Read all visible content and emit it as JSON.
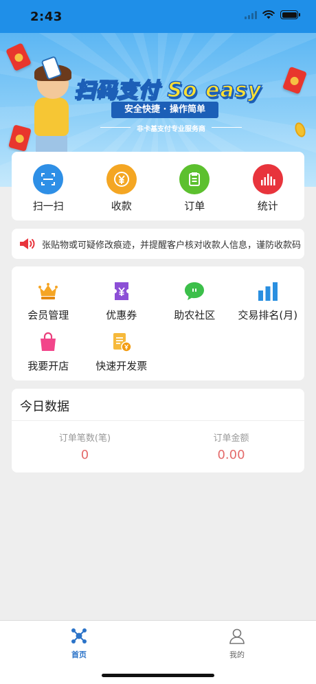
{
  "status_bar": {
    "time": "2:43"
  },
  "banner": {
    "slogan": "扫码支付 So easy",
    "subtitle": "安全快捷 · 操作简单",
    "tagline": "非卡基支付专业服务商"
  },
  "quick_actions": [
    {
      "label": "扫一扫",
      "icon": "scan-icon",
      "color": "#2e8fe6"
    },
    {
      "label": "收款",
      "icon": "collect-yen-icon",
      "color": "#f4a623"
    },
    {
      "label": "订单",
      "icon": "order-clipboard-icon",
      "color": "#5cc02e"
    },
    {
      "label": "统计",
      "icon": "statistics-bars-icon",
      "color": "#e8343c"
    }
  ],
  "notice": {
    "icon": "speaker-icon",
    "text": "张贴物或可疑修改痕迹，并提醒客户核对收款人信息，谨防收款码"
  },
  "services": [
    {
      "label": "会员管理",
      "icon": "crown-icon"
    },
    {
      "label": "优惠券",
      "icon": "coupon-icon"
    },
    {
      "label": "助农社区",
      "icon": "chat-bubble-icon"
    },
    {
      "label": "交易排名(月)",
      "icon": "ranking-bars-icon"
    },
    {
      "label": "我要开店",
      "icon": "shopping-bag-icon"
    },
    {
      "label": "快速开发票",
      "icon": "invoice-icon"
    }
  ],
  "today": {
    "title": "今日数据",
    "order_count_label": "订单笔数(笔)",
    "order_count": "0",
    "order_amount_label": "订单金额",
    "order_amount": "0.00"
  },
  "tabbar": [
    {
      "label": "首页",
      "icon": "home-network-icon",
      "active": true
    },
    {
      "label": "我的",
      "icon": "user-profile-icon",
      "active": false
    }
  ],
  "colors": {
    "primary": "#1f8fe8",
    "value_red": "#e46b6b",
    "tab_active": "#2b73c8"
  }
}
